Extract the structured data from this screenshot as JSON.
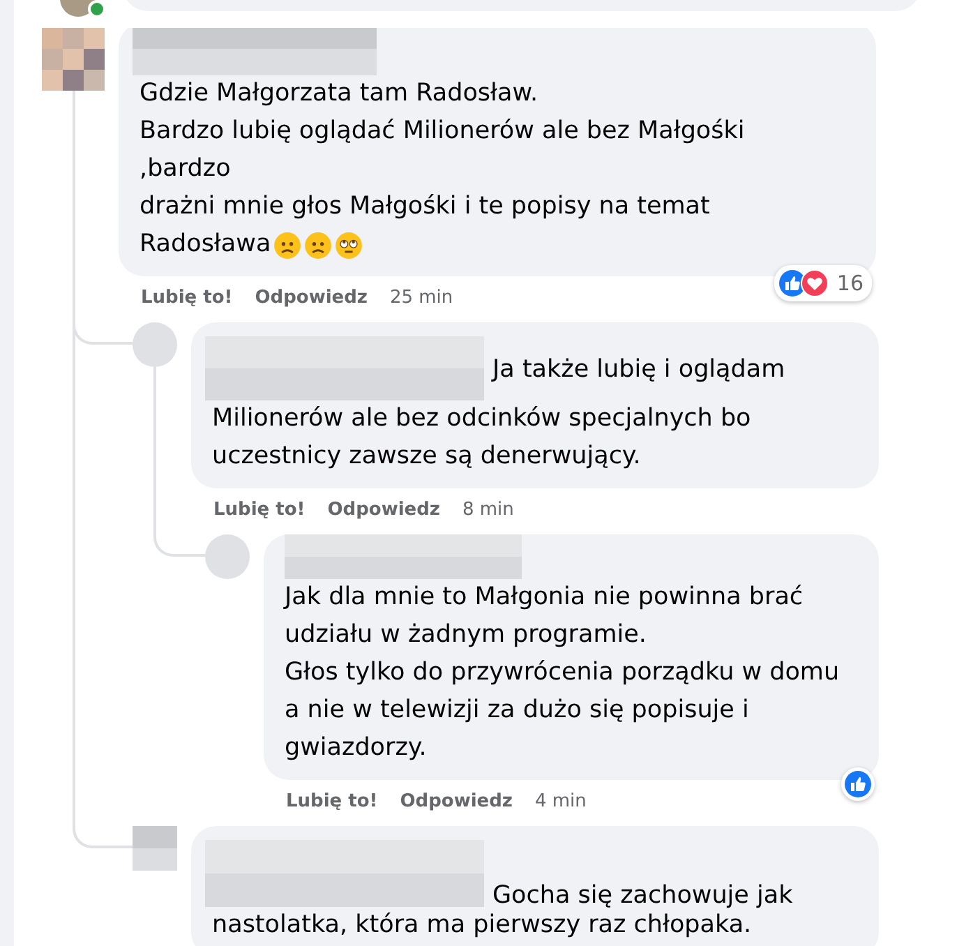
{
  "previous_comment": {
    "author_online": true
  },
  "comments": [
    {
      "name": {
        "kind": "pixelated"
      },
      "text": "Gdzie Małgorzata tam Radosław.\nBardzo lubię oglądać Milionerów ale bez Małgośki\n,bardzo\ndrażni mnie głos Małgośki i te popisy na temat\nRadosława",
      "emojis": [
        {
          "kind": "frowning"
        },
        {
          "kind": "frowning"
        },
        {
          "kind": "eye-roll"
        }
      ],
      "actions": {
        "like": "Lubię to!",
        "reply": "Odpowiedz",
        "time": "25 min"
      },
      "reactions": {
        "icons": [
          {
            "kind": "like"
          },
          {
            "kind": "love"
          }
        ],
        "count": "16"
      },
      "children": [
        {
          "name": {
            "kind": "pixelated-inline"
          },
          "text": "Ja także lubię i oglądam\nMilionerów ale bez odcinków specjalnych bo\nuczestnicy zawsze są denerwujący.",
          "actions": {
            "like": "Lubię to!",
            "reply": "Odpowiedz",
            "time": "8 min"
          },
          "children": [
            {
              "name": {
                "kind": "pixelated"
              },
              "text": "Jak dla mnie to Małgonia nie powinna brać\nudziału w żadnym programie.\nGłos tylko do przywrócenia porządku w domu\na nie w telewizji za dużo się popisuje i\ngwiazdorzy.",
              "actions": {
                "like": "Lubię to!",
                "reply": "Odpowiedz",
                "time": "4 min"
              },
              "reactions": {
                "icons": [
                  {
                    "kind": "like"
                  }
                ]
              }
            }
          ]
        },
        {
          "name": {
            "kind": "pixelated-inline"
          },
          "text": "Gocha się zachowuje jak\nnastolatka, która ma pierwszy raz chłopaka."
        }
      ]
    }
  ]
}
